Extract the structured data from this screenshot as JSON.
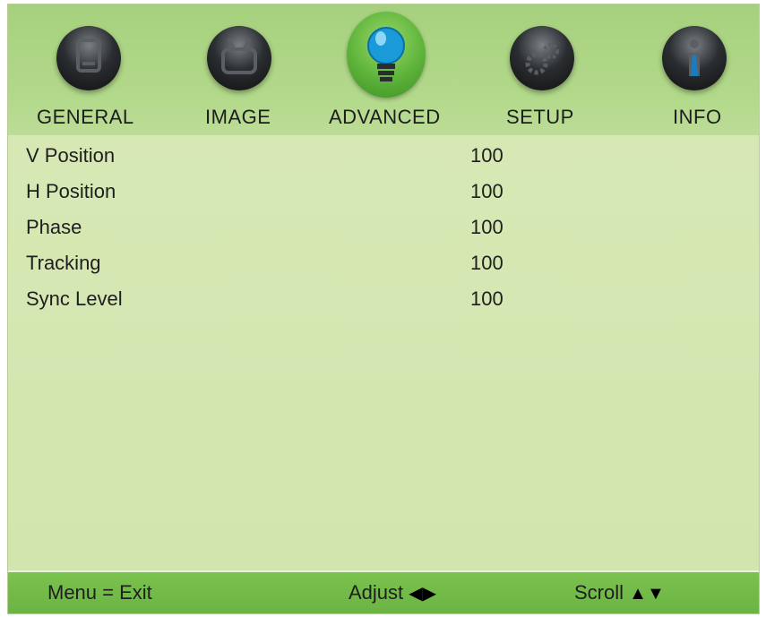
{
  "tabs": [
    {
      "label": "GENERAL",
      "icon": "document-icon"
    },
    {
      "label": "IMAGE",
      "icon": "tv-icon"
    },
    {
      "label": "ADVANCED",
      "icon": "lightbulb-icon",
      "active": true
    },
    {
      "label": "SETUP",
      "icon": "gears-icon"
    },
    {
      "label": "INFO",
      "icon": "info-icon"
    }
  ],
  "settings": [
    {
      "label": "V Position",
      "value": "100"
    },
    {
      "label": "H Position",
      "value": "100"
    },
    {
      "label": "Phase",
      "value": "100"
    },
    {
      "label": "Tracking",
      "value": "100"
    },
    {
      "label": "Sync Level",
      "value": "100"
    }
  ],
  "footer": {
    "menu": "Menu = Exit",
    "adjust": "Adjust",
    "scroll": "Scroll"
  },
  "colors": {
    "header": "#b0d888",
    "panel": "#d4e6b0",
    "footer": "#72b948",
    "active_icon": "#5db33a"
  }
}
